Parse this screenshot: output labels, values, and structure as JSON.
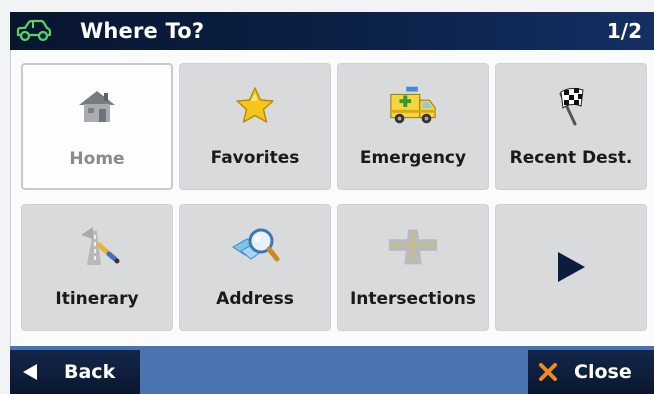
{
  "header": {
    "icon": "car-icon",
    "title": "Where To?",
    "page_indicator": "1/2"
  },
  "menu": [
    {
      "label": "Home",
      "icon": "home-icon",
      "selected": true
    },
    {
      "label": "Favorites",
      "icon": "star-icon",
      "selected": false
    },
    {
      "label": "Emergency",
      "icon": "ambulance-icon",
      "selected": false
    },
    {
      "label": "Recent Dest.",
      "icon": "checkered-flag-icon",
      "selected": false
    },
    {
      "label": "Itinerary",
      "icon": "road-pen-icon",
      "selected": false
    },
    {
      "label": "Address",
      "icon": "map-magnifier-icon",
      "selected": false
    },
    {
      "label": "Intersections",
      "icon": "intersection-icon",
      "selected": false
    },
    {
      "label": "",
      "icon": "next-arrow-icon",
      "selected": false
    }
  ],
  "footer": {
    "back_label": "Back",
    "close_label": "Close"
  },
  "colors": {
    "title_bar": "#0c2148",
    "bottom_bar": "#4a73b3",
    "tile": "#d9dadc",
    "selected_tile": "#fdfdfd"
  }
}
